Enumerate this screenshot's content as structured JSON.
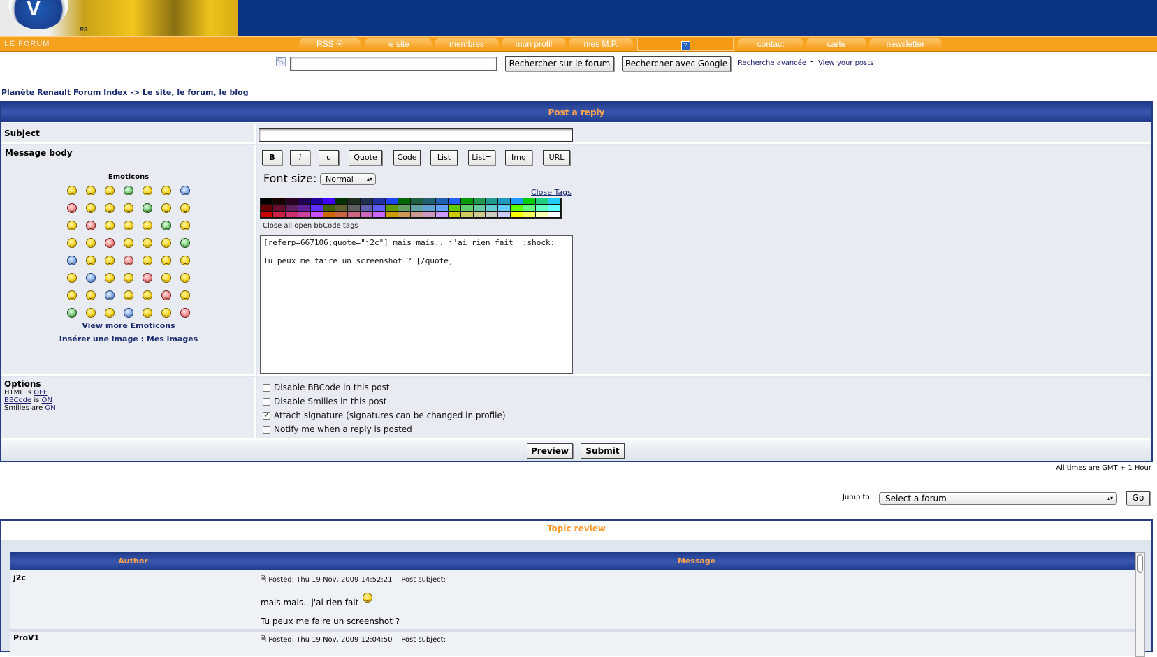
{
  "nav": {
    "forum_label": "LE FORUM",
    "tabs": [
      "RSS",
      "le site",
      "membres",
      "mon profil",
      "mes M.P.",
      "",
      "contact",
      "carte",
      "newsletter"
    ]
  },
  "search": {
    "button_forum": "Rechercher sur le forum",
    "button_google": "Rechercher avec Google",
    "advanced_link": "Recherche avancée",
    "separator": "-",
    "view_posts_link": "View your posts"
  },
  "breadcrumb": {
    "index": "Planète Renault Forum Index",
    "arrow": "->",
    "forum": "Le site, le forum, le blog"
  },
  "post": {
    "title": "Post a reply",
    "subject_label": "Subject",
    "subject_value": "",
    "body_label": "Message body",
    "emoticons_title": "Emoticons",
    "view_more_emoticons": "View more Emoticons",
    "insert_image": "Insérer une image",
    "insert_sep": ":",
    "my_images": "Mes images",
    "bbcode_buttons": [
      "B",
      "i",
      "u",
      "Quote",
      "Code",
      "List",
      "List=",
      "Img",
      "URL"
    ],
    "font_size_label": "Font size:",
    "font_size_value": "Normal",
    "close_tags": "Close Tags",
    "close_tags_hint": "Close all open bbCode tags",
    "message_text": "[referp=667106;quote=\"j2c\"] mais mais.. j'ai rien fait  :shock:\n\nTu peux me faire un screenshot ? [/quote]",
    "options_label": "Options",
    "html_status": [
      "HTML",
      "is",
      "OFF"
    ],
    "bbcode_status": [
      "BBCode",
      "is",
      "ON"
    ],
    "smilies_status": [
      "Smilies",
      "are",
      "ON"
    ],
    "options": [
      {
        "label": "Disable BBCode in this post",
        "checked": false
      },
      {
        "label": "Disable Smilies in this post",
        "checked": false
      },
      {
        "label": "Attach signature (signatures can be changed in profile)",
        "checked": true
      },
      {
        "label": "Notify me when a reply is posted",
        "checked": false
      }
    ],
    "preview_button": "Preview",
    "submit_button": "Submit"
  },
  "footer": {
    "timezone": "All times are GMT + 1 Hour",
    "jump_label": "Jump to:",
    "jump_value": "Select a forum",
    "go_button": "Go"
  },
  "review": {
    "title": "Topic review",
    "col_author": "Author",
    "col_message": "Message",
    "posts": [
      {
        "author": "j2c",
        "posted": "Posted: Thu 19 Nov, 2009 14:52:21",
        "subject": "Post subject:",
        "line1": "mais mais.. j'ai rien fait",
        "line2": "Tu peux me faire un screenshot ?"
      },
      {
        "author": "ProV1",
        "posted": "Posted: Thu 19 Nov, 2009 12:04:50",
        "subject": "Post subject:"
      }
    ]
  },
  "colors": {
    "header_blue": "#0b3384",
    "nav_orange": "#f7a21e",
    "caption_orange": "#ffa44c",
    "panel_bg": "#e8ecf2"
  }
}
